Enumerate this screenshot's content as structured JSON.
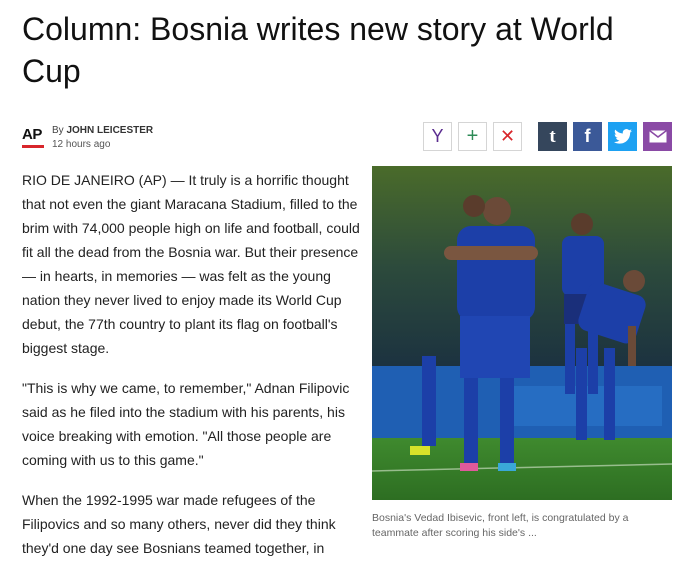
{
  "article": {
    "headline": "Column: Bosnia writes new story at World Cup",
    "byline_prefix": "By",
    "author": "JOHN LEICESTER",
    "timestamp": "12 hours ago",
    "paragraphs": [
      "RIO DE JANEIRO (AP) — It truly is a horrific thought that not even the giant Maracana Stadium, filled to the brim with 74,000 people high on life and football, could fit all the dead from the Bosnia war. But their presence — in hearts, in memories — was felt as the young nation they never lived to enjoy made its World Cup debut, the 77th country to plant its flag on football's biggest stage.",
      "\"This is why we came, to remember,\" Adnan Filipovic said as he filed into the stadium with his parents, his voice breaking with emotion. \"All those people are coming with us to this game.\"",
      "When the 1992-1995 war made refugees of the Filipovics and so many others, never did they think they'd one day see Bosnians teamed together, in"
    ]
  },
  "logo": {
    "text": "AP",
    "accent": "#d8262b"
  },
  "share": [
    {
      "name": "yahoo",
      "glyph": "Y",
      "color": "#5b2d90"
    },
    {
      "name": "add",
      "glyph": "+",
      "color": "#2e8b57"
    },
    {
      "name": "remove",
      "glyph": "✕",
      "color": "#d8262b"
    },
    {
      "name": "tumblr",
      "glyph": "t",
      "color": "#35465c"
    },
    {
      "name": "facebook",
      "glyph": "f",
      "color": "#3b5998"
    },
    {
      "name": "twitter",
      "glyph": "twitter-bird",
      "color": "#1da1f2"
    },
    {
      "name": "email",
      "glyph": "envelope",
      "color": "#8a4aa5"
    }
  ],
  "photo": {
    "caption": "Bosnia's Vedad Ibisevic, front left, is congratulated by a teammate after scoring his side's ..."
  }
}
